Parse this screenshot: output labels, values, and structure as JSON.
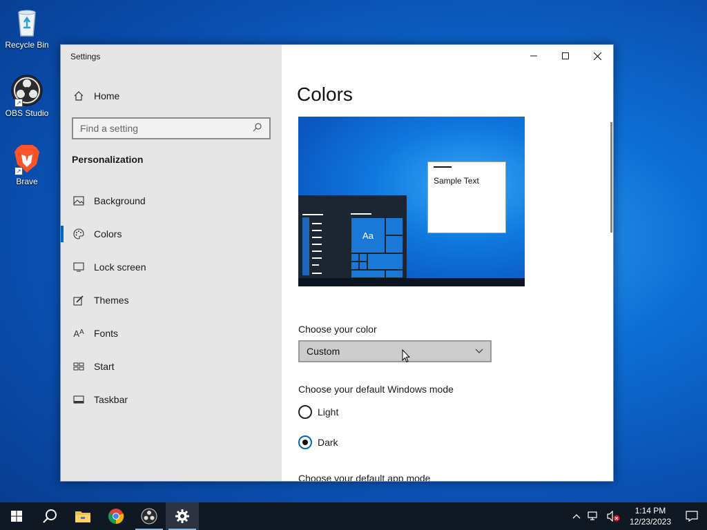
{
  "desktop": {
    "icons": [
      {
        "label": "Recycle Bin"
      },
      {
        "label": "OBS Studio"
      },
      {
        "label": "Brave"
      }
    ]
  },
  "window": {
    "title": "Settings",
    "controls": {
      "minimize": "minimize",
      "maximize": "maximize",
      "close": "close"
    }
  },
  "sidebar": {
    "home": "Home",
    "search_placeholder": "Find a setting",
    "section": "Personalization",
    "items": [
      {
        "label": "Background",
        "icon": "image-icon"
      },
      {
        "label": "Colors",
        "icon": "palette-icon",
        "active": true
      },
      {
        "label": "Lock screen",
        "icon": "monitor-lock-icon"
      },
      {
        "label": "Themes",
        "icon": "brush-icon"
      },
      {
        "label": "Fonts",
        "icon": "font-icon"
      },
      {
        "label": "Start",
        "icon": "start-tiles-icon"
      },
      {
        "label": "Taskbar",
        "icon": "taskbar-icon"
      }
    ]
  },
  "content": {
    "title": "Colors",
    "preview": {
      "sample_text": "Sample Text",
      "tile_label": "Aa"
    },
    "choose_color_label": "Choose your color",
    "choose_color_value": "Custom",
    "windows_mode_label": "Choose your default Windows mode",
    "windows_mode_options": [
      {
        "label": "Light",
        "checked": false
      },
      {
        "label": "Dark",
        "checked": true
      }
    ],
    "app_mode_label": "Choose your default app mode"
  },
  "taskbar": {
    "apps": [
      "start-icon",
      "search-icon",
      "file-explorer-icon",
      "chrome-icon",
      "obs-icon",
      "settings-icon"
    ],
    "clock_time": "1:14 PM",
    "clock_date": "12/23/2023"
  },
  "colors": {
    "accent": "#0067c0",
    "sidebar_bg": "#e6e6e6",
    "taskbar_bg": "#101923"
  }
}
